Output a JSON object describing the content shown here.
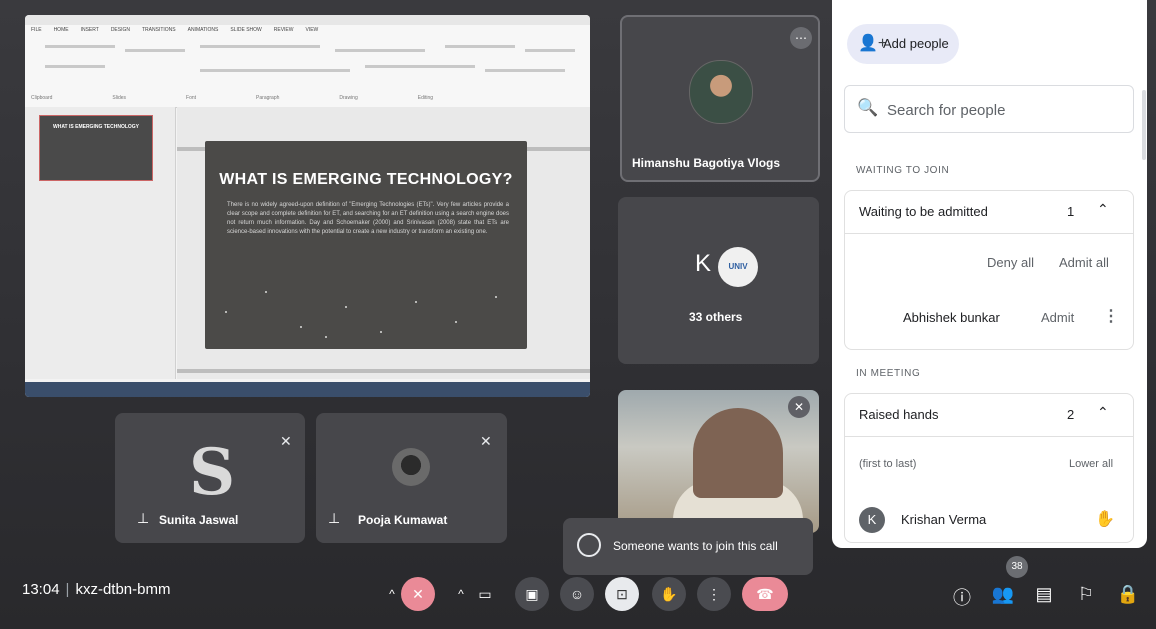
{
  "presentation": {
    "slide_title": "WHAT IS EMERGING TECHNOLOGY?",
    "slide_body": "There is no widely agreed-upon definition of \"Emerging Technologies (ETs)\". Very few articles provide a clear scope and complete definition for ET, and searching for an ET definition using a search engine does not return much information. Day and Schoemaker (2000) and Srinivasan (2008) state that ETs are science-based innovations with the potential to create a new industry or transform an existing one.",
    "thumb_title": "WHAT IS EMERGING TECHNOLOGY"
  },
  "tiles": {
    "himanshu": {
      "name": "Himanshu Bagotiya Vlogs"
    },
    "others": {
      "letter": "K",
      "label": "33 others",
      "logo_text": "UNIV"
    },
    "sunita": {
      "name": "Sunita Jaswal"
    },
    "pooja": {
      "name": "Pooja Kumawat"
    }
  },
  "toast": {
    "text": "Someone wants to join this call"
  },
  "bottom_bar": {
    "time": "13:04",
    "meeting_code": "kxz-dtbn-bmm",
    "participants_badge": "38"
  },
  "people_panel": {
    "add_people": "Add people",
    "search_placeholder": "Search for people",
    "waiting_section": "WAITING TO JOIN",
    "waiting_group": {
      "title": "Waiting to be admitted",
      "count": "1"
    },
    "deny_all": "Deny all",
    "admit_all": "Admit all",
    "waiting_person": {
      "name": "Abhishek bunkar",
      "admit": "Admit"
    },
    "meeting_section": "IN MEETING",
    "raised_group": {
      "title": "Raised hands",
      "count": "2"
    },
    "order_hint": "(first to last)",
    "lower_all": "Lower all",
    "raised_person": {
      "initial": "K",
      "name": "Krishan Verma"
    }
  },
  "icons": {
    "add": "person-add-icon",
    "search": "search-icon",
    "chevron": "chevron-up-icon",
    "more": "more-vert-icon",
    "hand": "raise-hand-icon",
    "mic_off": "mic-off-icon",
    "pin": "pin-icon"
  },
  "colors": {
    "accent_red": "#ea8a97",
    "panel_bg": "#ffffff",
    "stage_bg": "#2f2f33"
  }
}
